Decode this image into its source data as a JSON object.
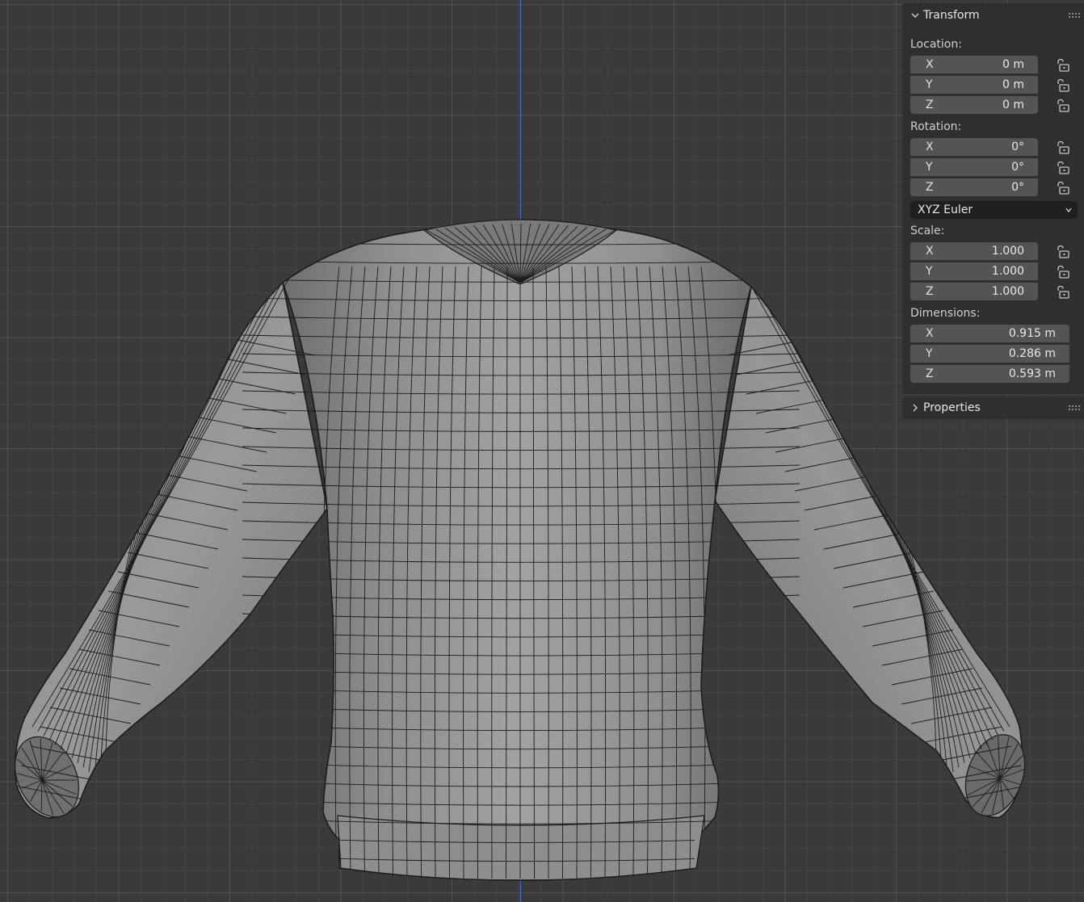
{
  "transform": {
    "title": "Transform",
    "location": {
      "label": "Location:",
      "x": {
        "axis": "X",
        "value": "0 m"
      },
      "y": {
        "axis": "Y",
        "value": "0 m"
      },
      "z": {
        "axis": "Z",
        "value": "0 m"
      }
    },
    "rotation": {
      "label": "Rotation:",
      "x": {
        "axis": "X",
        "value": "0°"
      },
      "y": {
        "axis": "Y",
        "value": "0°"
      },
      "z": {
        "axis": "Z",
        "value": "0°"
      },
      "mode": "XYZ Euler"
    },
    "scale": {
      "label": "Scale:",
      "x": {
        "axis": "X",
        "value": "1.000"
      },
      "y": {
        "axis": "Y",
        "value": "1.000"
      },
      "z": {
        "axis": "Z",
        "value": "1.000"
      }
    },
    "dimensions": {
      "label": "Dimensions:",
      "x": {
        "axis": "X",
        "value": "0.915 m"
      },
      "y": {
        "axis": "Y",
        "value": "0.286 m"
      },
      "z": {
        "axis": "Z",
        "value": "0.593 m"
      }
    }
  },
  "properties": {
    "title": "Properties"
  },
  "icons": {
    "expand": "chevron-down-icon",
    "collapse": "chevron-right-icon",
    "lock": "lock-icon",
    "grip": "drag-grip-icon",
    "dropdown": "chevron-down-icon"
  },
  "colors": {
    "viewport": "#3a3a3a",
    "panel": "#2f2f2f",
    "field": "#545454",
    "z_axis": "#4a6fd0",
    "mesh": "#9a9a9a"
  }
}
